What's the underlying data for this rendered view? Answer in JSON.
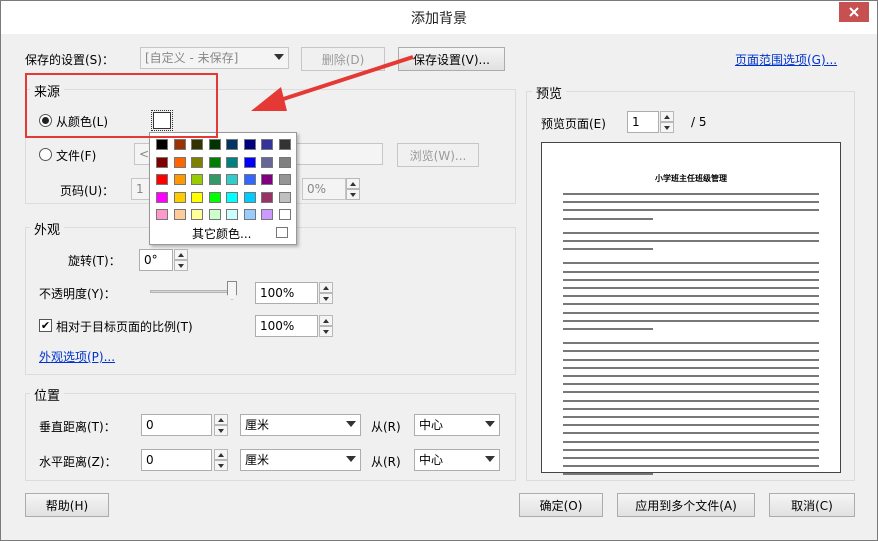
{
  "window": {
    "title": "添加背景"
  },
  "settings": {
    "label": "保存的设置(S)：",
    "value": "[自定义 - 未保存]",
    "delete_label": "删除(D)",
    "save_label": "保存设置(V)...",
    "page_range_link": "页面范围选项(G)..."
  },
  "source": {
    "title": "来源",
    "from_color_label": "从颜色(L)",
    "from_file_label": "文件(F)",
    "file_path_value": "<",
    "browse_label": "浏览(W)...",
    "page_number_label": "页码(U)：",
    "page_number_value": "1",
    "scale_value": "0%",
    "more_colors_label": "其它颜色...",
    "palette": [
      [
        "#000000",
        "#993300",
        "#333300",
        "#003300",
        "#003366",
        "#000080",
        "#333399",
        "#333333"
      ],
      [
        "#800000",
        "#ff6600",
        "#808000",
        "#008000",
        "#008080",
        "#0000ff",
        "#666699",
        "#808080"
      ],
      [
        "#ff0000",
        "#ff9900",
        "#99cc00",
        "#339966",
        "#33cccc",
        "#3366ff",
        "#800080",
        "#969696"
      ],
      [
        "#ff00ff",
        "#ffcc00",
        "#ffff00",
        "#00ff00",
        "#00ffff",
        "#00ccff",
        "#993366",
        "#c0c0c0"
      ],
      [
        "#ff99cc",
        "#ffcc99",
        "#ffff99",
        "#ccffcc",
        "#ccffff",
        "#99ccff",
        "#cc99ff",
        "#ffffff"
      ]
    ]
  },
  "appearance": {
    "title": "外观",
    "rotation_label": "旋转(T)：",
    "rotation_value": "0°",
    "opacity_label": "不透明度(Y)：",
    "opacity_value": "100%",
    "opacity_level": 1.0,
    "relative_label": "相对于目标页面的比例(T)",
    "relative_checked": true,
    "relative_value": "100%",
    "options_link": "外观选项(P)..."
  },
  "position": {
    "title": "位置",
    "vertical_label": "垂直距离(T)：",
    "vertical_value": "0",
    "vertical_unit": "厘米",
    "horizontal_label": "水平距离(Z)：",
    "horizontal_value": "0",
    "horizontal_unit": "厘米",
    "from_label": "从(R)",
    "vertical_from": "中心",
    "horizontal_from": "中心"
  },
  "preview": {
    "title": "预览",
    "page_label": "预览页面(E)",
    "page_value": "1",
    "page_total": "/ 5",
    "doc_title": "小学班主任班级管理"
  },
  "footer": {
    "help_label": "帮助(H)",
    "ok_label": "确定(O)",
    "apply_multi_label": "应用到多个文件(A)",
    "cancel_label": "取消(C)"
  },
  "annotation": {
    "highlight_color": "#e53935",
    "arrow_color": "#e53935"
  }
}
